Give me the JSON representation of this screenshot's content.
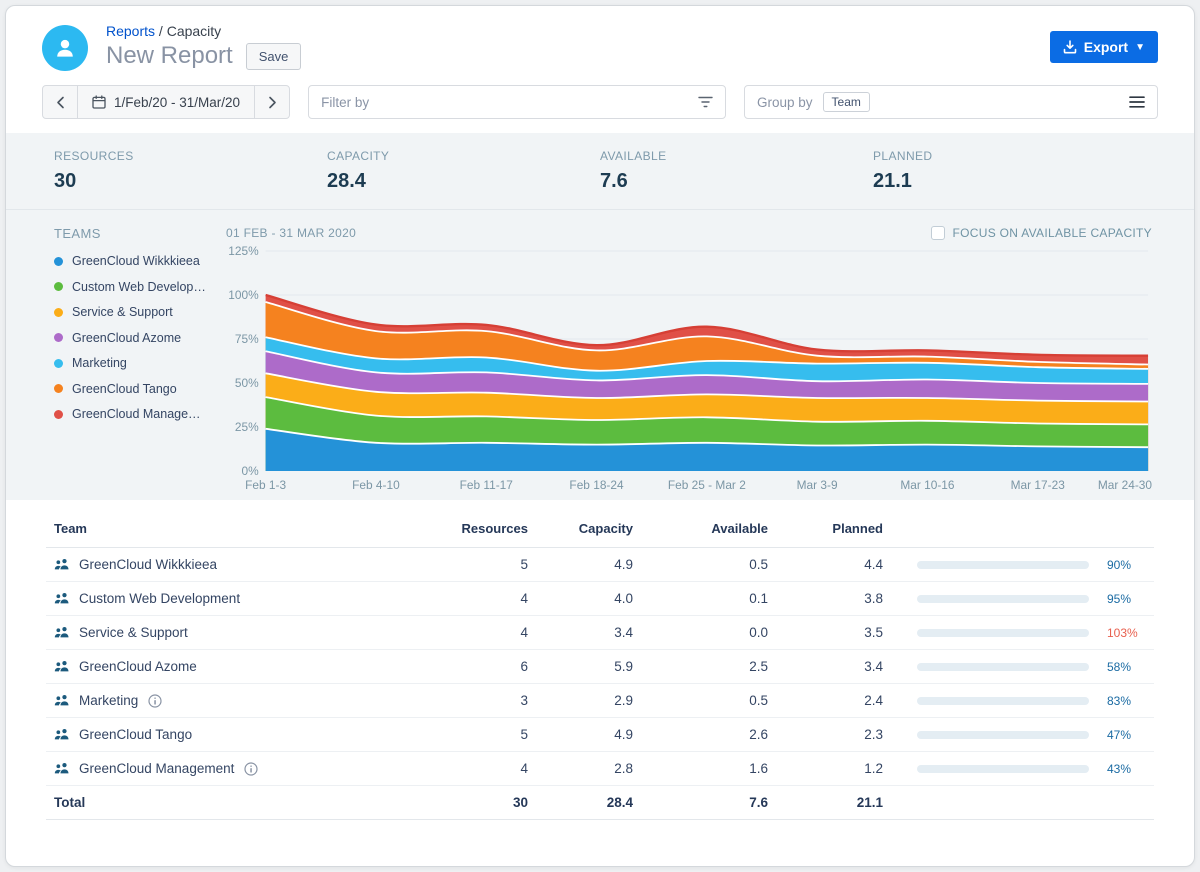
{
  "header": {
    "breadcrumb_link": "Reports",
    "breadcrumb_separator": "/",
    "breadcrumb_current": "Capacity",
    "title": "New Report",
    "save_label": "Save",
    "export_label": "Export"
  },
  "toolbar": {
    "date_range": "1/Feb/20 - 31/Mar/20",
    "filter_placeholder": "Filter by",
    "group_by_label": "Group by",
    "group_by_value": "Team"
  },
  "stats": [
    {
      "label": "RESOURCES",
      "value": "30"
    },
    {
      "label": "CAPACITY",
      "value": "28.4"
    },
    {
      "label": "AVAILABLE",
      "value": "7.6"
    },
    {
      "label": "PLANNED",
      "value": "21.1"
    }
  ],
  "chart": {
    "legend_title": "TEAMS",
    "title": "01 FEB - 31 MAR 2020",
    "focus_label": "FOCUS ON AVAILABLE CAPACITY",
    "focus_checked": false
  },
  "chart_data": {
    "type": "area",
    "stacked": true,
    "grid": true,
    "legend_position": "left",
    "ylim": [
      0,
      125
    ],
    "y_ticks": [
      "0%",
      "25%",
      "50%",
      "75%",
      "100%",
      "125%"
    ],
    "x": [
      "Feb 1-3",
      "Feb 4-10",
      "Feb 11-17",
      "Feb 18-24",
      "Feb 25 - Mar 2",
      "Mar 3-9",
      "Mar 10-16",
      "Mar 17-23",
      "Mar 24-30"
    ],
    "unit": "percent of capacity planned",
    "series": [
      {
        "name": "GreenCloud Wikkkieea",
        "legend_label": "GreenCloud Wikkkieea",
        "color": "#2492d8",
        "values": [
          24,
          16,
          16,
          15,
          16,
          14.5,
          15,
          14,
          13.5
        ]
      },
      {
        "name": "Custom Web Development",
        "legend_label": "Custom Web Develop…",
        "color": "#5cbc3f",
        "values": [
          18,
          15.5,
          15,
          14,
          14.5,
          13.5,
          13.5,
          13,
          13
        ]
      },
      {
        "name": "Service & Support",
        "legend_label": "Service & Support",
        "color": "#fbad18",
        "values": [
          13.5,
          13.5,
          13.5,
          12.5,
          13,
          13.5,
          13,
          13,
          13
        ]
      },
      {
        "name": "GreenCloud Azome",
        "legend_label": "GreenCloud Azome",
        "color": "#ad6bc9",
        "values": [
          12.5,
          11,
          11.5,
          10,
          11,
          9.5,
          10.5,
          10,
          10
        ]
      },
      {
        "name": "Marketing",
        "legend_label": "Marketing",
        "color": "#36bdee",
        "values": [
          8,
          8,
          8.5,
          5.5,
          8,
          10,
          9.5,
          9,
          8.5
        ]
      },
      {
        "name": "GreenCloud Tango",
        "legend_label": "GreenCloud Tango",
        "color": "#f5821f",
        "values": [
          20,
          15.5,
          15,
          11.5,
          14,
          4.5,
          3.5,
          3,
          2.5
        ]
      },
      {
        "name": "GreenCloud Management",
        "legend_label": "GreenCloud Manage…",
        "color": "#e05047",
        "values": [
          4,
          3.7,
          3.5,
          3,
          5.5,
          3.5,
          3.5,
          4,
          5
        ]
      }
    ]
  },
  "table": {
    "columns": [
      "Team",
      "Resources",
      "Capacity",
      "Available",
      "Planned"
    ],
    "rows": [
      {
        "team": "GreenCloud Wikkkieea",
        "info": false,
        "resources": "5",
        "capacity": "4.9",
        "available": "0.5",
        "planned": "4.4",
        "pct": 90,
        "over": false
      },
      {
        "team": "Custom Web Development",
        "info": false,
        "resources": "4",
        "capacity": "4.0",
        "available": "0.1",
        "planned": "3.8",
        "pct": 95,
        "over": false
      },
      {
        "team": "Service & Support",
        "info": false,
        "resources": "4",
        "capacity": "3.4",
        "available": "0.0",
        "planned": "3.5",
        "pct": 103,
        "over": true
      },
      {
        "team": "GreenCloud Azome",
        "info": false,
        "resources": "6",
        "capacity": "5.9",
        "available": "2.5",
        "planned": "3.4",
        "pct": 58,
        "over": false
      },
      {
        "team": "Marketing",
        "info": true,
        "resources": "3",
        "capacity": "2.9",
        "available": "0.5",
        "planned": "2.4",
        "pct": 83,
        "over": false
      },
      {
        "team": "GreenCloud Tango",
        "info": false,
        "resources": "5",
        "capacity": "4.9",
        "available": "2.6",
        "planned": "2.3",
        "pct": 47,
        "over": false
      },
      {
        "team": "GreenCloud Management",
        "info": true,
        "resources": "4",
        "capacity": "2.8",
        "available": "1.6",
        "planned": "1.2",
        "pct": 43,
        "over": false
      }
    ],
    "total": {
      "label": "Total",
      "resources": "30",
      "capacity": "28.4",
      "available": "7.6",
      "planned": "21.1"
    }
  },
  "colors": {
    "accent_blue": "#0b6ce4",
    "avatar_bg": "#2cb9f1",
    "bar_fill": "#1c5a7d",
    "bar_over": "#f28172",
    "bar_track": "#e4edf3",
    "pct_text": "#1b6ba3",
    "pct_text_over": "#e8604f",
    "panel_bg": "#f1f4f6",
    "grid_line": "#e2e9ee",
    "stack_top_stroke": "#d63f35"
  }
}
